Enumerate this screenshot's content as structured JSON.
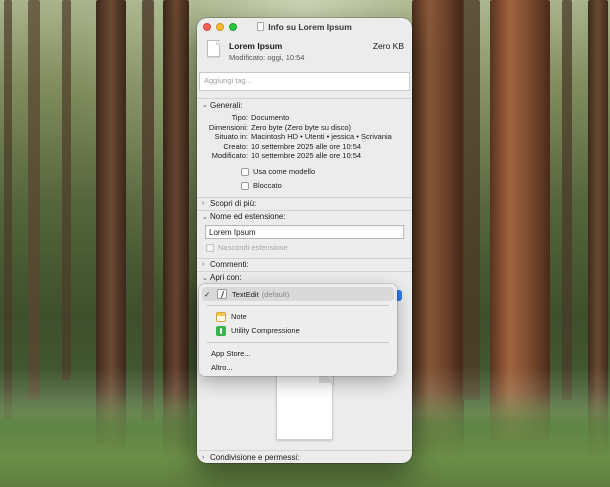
{
  "window": {
    "title": "Info su Lorem Ipsum"
  },
  "file": {
    "name": "Lorem Ipsum",
    "size": "Zero KB",
    "modified": "Modificato: oggi, 10:54"
  },
  "tags": {
    "placeholder": "Aggiungi tag..."
  },
  "sections": {
    "general": "Generali:",
    "more_info": "Scopri di più:",
    "name_ext": "Nome ed estensione:",
    "comments": "Commenti:",
    "open_with": "Apri con:",
    "sharing": "Condivisione e permessi:"
  },
  "general": {
    "rows": [
      {
        "key": "Tipo:",
        "value": "Documento"
      },
      {
        "key": "Dimensioni:",
        "value": "Zero byte (Zero byte su disco)"
      },
      {
        "key": "Situato in:",
        "value": "Macintosh HD • Utenti • jessica • Scrivania"
      },
      {
        "key": "Creato:",
        "value": "10 settembre 2025 alle ore 10:54"
      },
      {
        "key": "Modificato:",
        "value": "10 settembre 2025 alle ore 10:54"
      }
    ],
    "stationery_label": "Usa come modello",
    "locked_label": "Bloccato"
  },
  "name_ext": {
    "value": "Lorem Ipsum",
    "hide_ext_label": "Nascondi estensione"
  },
  "open_with_menu": {
    "selected_app": "TextEdit",
    "selected_suffix": "(default)",
    "apps": [
      "Note",
      "Utility Compressione"
    ],
    "app_store": "App Store...",
    "other": "Altro..."
  }
}
